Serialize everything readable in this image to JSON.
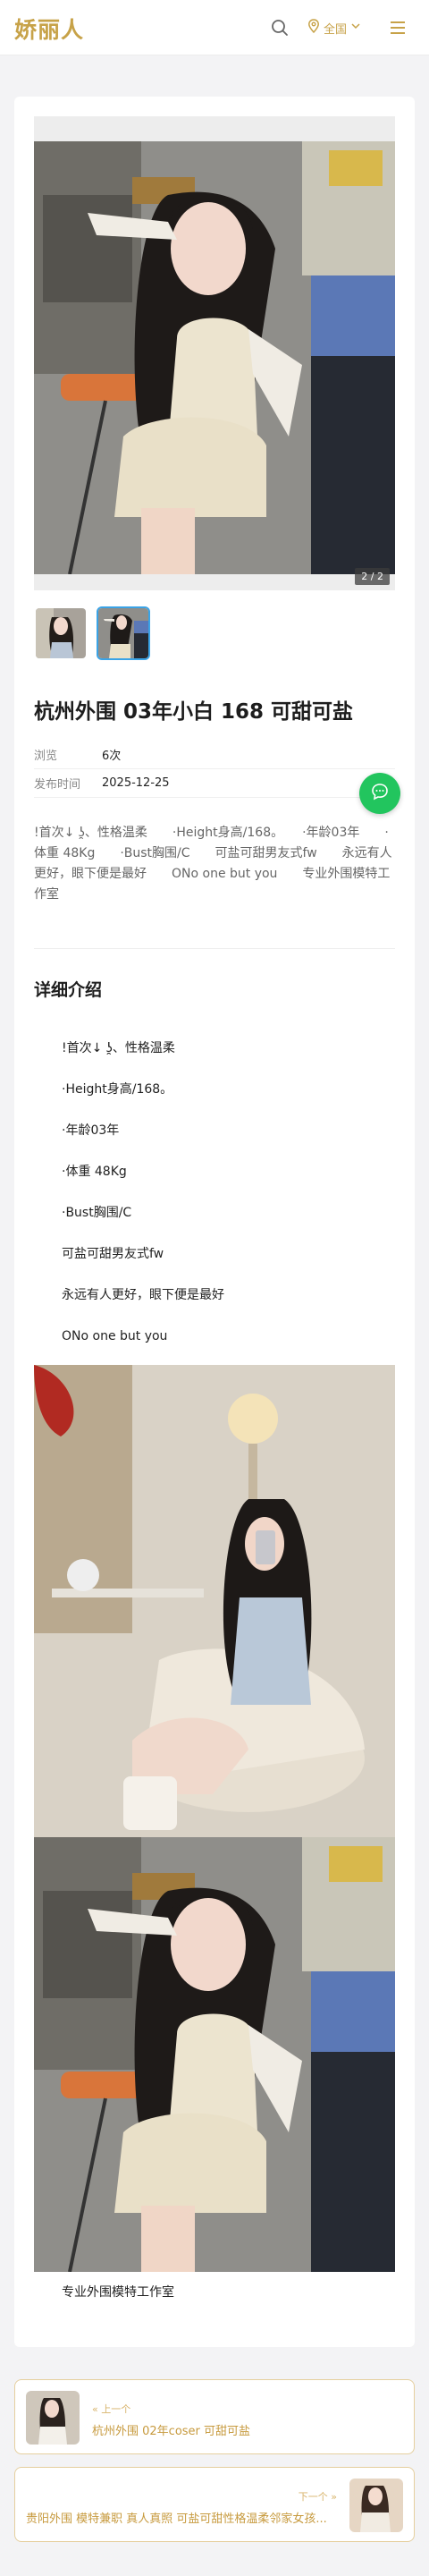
{
  "header": {
    "logo": "娇丽人",
    "region_label": "全国",
    "icons": [
      "search-icon",
      "location-pin-icon",
      "chevron-down-icon",
      "menu-icon"
    ],
    "accent": "#c7a248"
  },
  "gallery": {
    "counter": "2 / 2",
    "thumb_count": 2,
    "active_thumb": 2
  },
  "post": {
    "title": "杭州外围 03年小白 168 可甜可盐",
    "meta": [
      {
        "key": "浏览",
        "value": "6次"
      },
      {
        "key": "发布时间",
        "value": "2025-12-25"
      }
    ],
    "summary": "!首次↓ ʖ̯、性格温柔　　·Height身高/168。　　·年龄03年　　·体重 48Kg　　·Bust胸围/C　　可盐可甜男友式fw　　永远有人更好，眼下便是最好　　ONo one but you　　专业外围模特工作室"
  },
  "detail": {
    "section_title": "详细介绍",
    "lines": [
      "!首次↓ ʖ̯、性格温柔",
      "·Height身高/168。",
      "·年龄03年",
      "·体重 48Kg",
      "·Bust胸围/C",
      "可盐可甜男友式fw",
      "永远有人更好，眼下便是最好",
      "ONo one but you"
    ],
    "footer_line": "专业外围模特工作室"
  },
  "nav": {
    "prev_label": "« 上一个",
    "prev_title": "杭州外围 02年coser 可甜可盐",
    "next_label": "下一个 »",
    "next_title": "贵阳外围 模特兼职 真人真照 可盐可甜性格温柔邻家女孩..."
  },
  "fab": {
    "icon": "chat-bubble-icon",
    "color": "#22c55e"
  }
}
